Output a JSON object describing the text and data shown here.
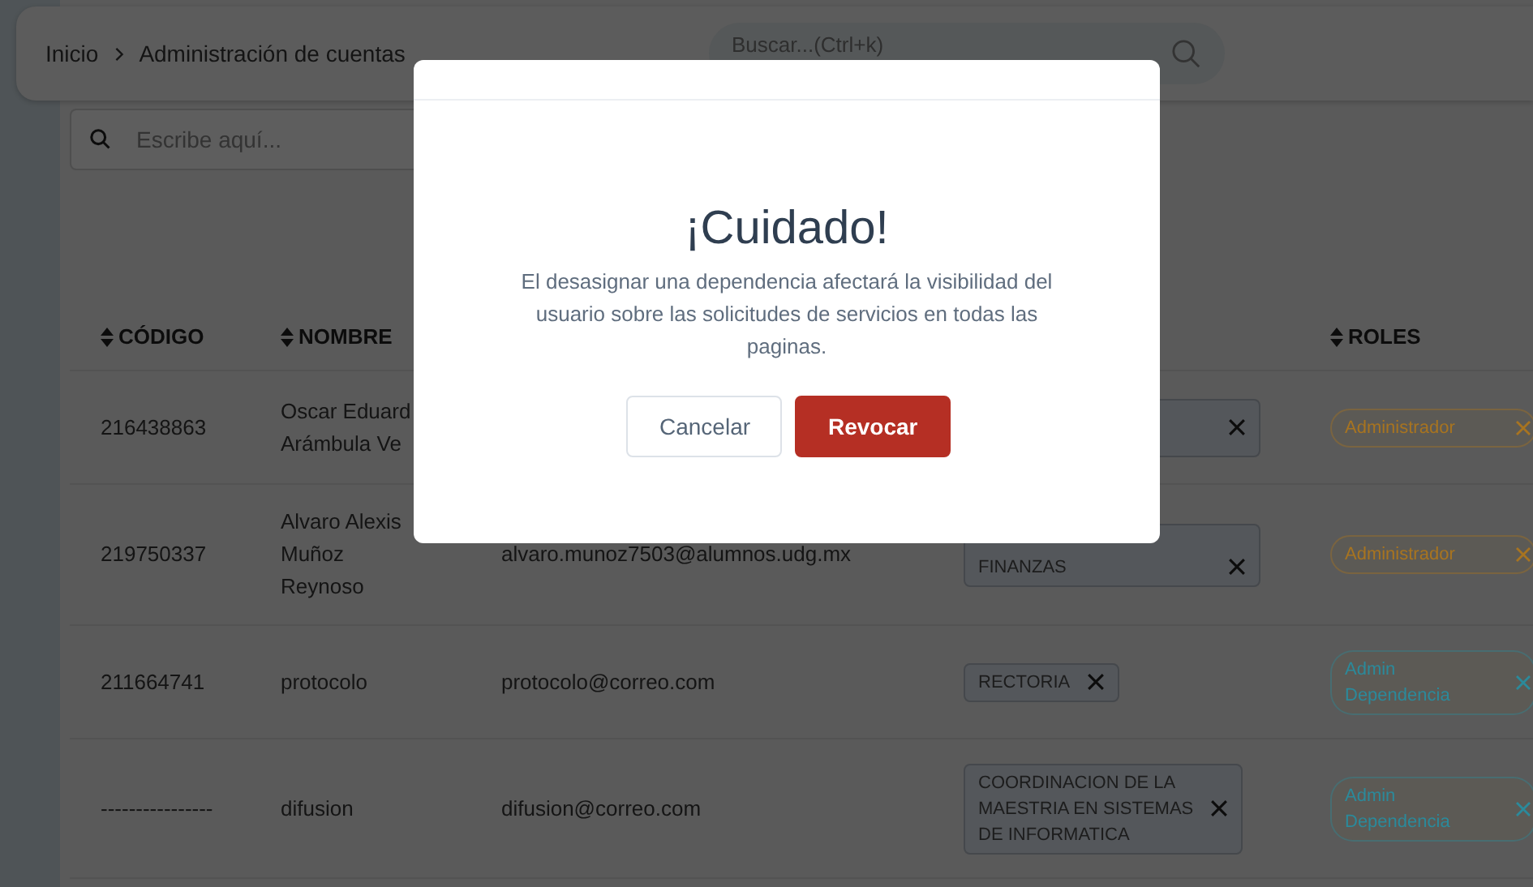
{
  "breadcrumb": [
    "Inicio",
    "Administración de cuentas"
  ],
  "global_search": {
    "placeholder": "Buscar...(Ctrl+k)"
  },
  "table_search": {
    "placeholder": "Escribe aquí..."
  },
  "columns": [
    {
      "label": "CÓDIGO",
      "kind": "code"
    },
    {
      "label": "NOMBRE",
      "kind": "name"
    },
    {
      "kind": "email"
    },
    {
      "kind": "deps"
    },
    {
      "label": "ROLES",
      "kind": "roles"
    }
  ],
  "rows": [
    {
      "code": "216438863",
      "name": [
        "Oscar Eduard",
        "Arámbula Ve"
      ],
      "email": "",
      "dependencies": [
        {
          "removable": true
        }
      ],
      "roles": [
        {
          "label": [
            "Administrador"
          ],
          "color": "#a87420"
        }
      ]
    },
    {
      "code": "219750337",
      "name": [
        "Alvaro Alexis",
        "Muñoz",
        "Reynoso"
      ],
      "email": "alvaro.munoz7503@alumnos.udg.mx",
      "dependencies": [
        {
          "label": [
            "FINANZAS"
          ],
          "removable": true
        }
      ],
      "roles": [
        {
          "label": [
            "Administrador"
          ],
          "color": "#a87420"
        }
      ]
    },
    {
      "code": "211664741",
      "name": [
        "protocolo"
      ],
      "email": "protocolo@correo.com",
      "dependencies": [
        {
          "label": [
            "RECTORIA"
          ],
          "removable": true
        }
      ],
      "roles": [
        {
          "label": [
            "Admin",
            "Dependencia"
          ],
          "color": "#2b8a9b"
        }
      ]
    },
    {
      "code": "----------------",
      "name": [
        "difusion"
      ],
      "email": "difusion@correo.com",
      "dependencies": [
        {
          "label": [
            "COORDINACION DE LA",
            "MAESTRIA EN SISTEMAS",
            "DE INFORMATICA"
          ],
          "removable": true
        }
      ],
      "roles": [
        {
          "label": [
            "Admin",
            "Dependencia"
          ],
          "color": "#2b8a9b"
        }
      ]
    }
  ],
  "modal": {
    "title": "¡Cuidado!",
    "message": "El desasignar una dependencia afectará la visibilidad del usuario sobre las solicitudes de servicios en todas las paginas.",
    "buttons": [
      {
        "label": "Cancelar",
        "kind": "secondary"
      },
      {
        "label": "Revocar",
        "kind": "danger"
      }
    ]
  }
}
